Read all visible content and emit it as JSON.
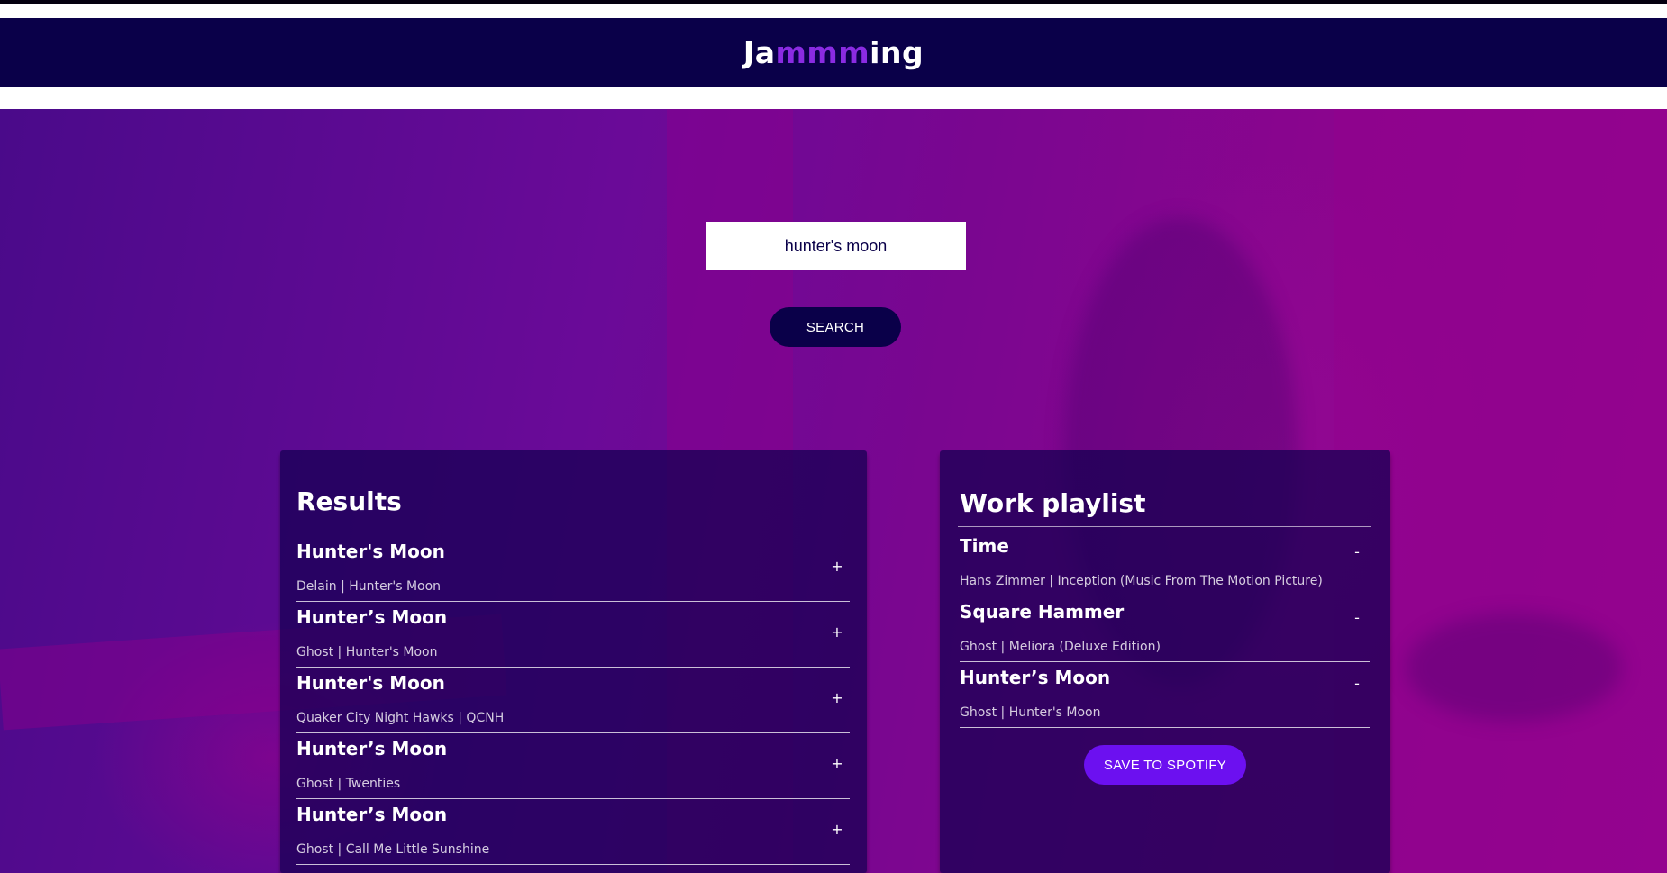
{
  "header": {
    "brand_prefix": "Ja",
    "brand_accent": "mmm",
    "brand_suffix": "ing"
  },
  "colors": {
    "header_bg": "#0a0049",
    "accent": "#8a2be2",
    "save_button": "#6c10f0"
  },
  "search": {
    "value": "hunter's moon",
    "button_label": "SEARCH"
  },
  "results": {
    "title": "Results",
    "add_icon": "+",
    "tracks": [
      {
        "name": "Hunter's Moon",
        "info": "Delain | Hunter's Moon"
      },
      {
        "name": "Hunter’s Moon",
        "info": "Ghost | Hunter's Moon"
      },
      {
        "name": "Hunter's Moon",
        "info": "Quaker City Night Hawks | QCNH"
      },
      {
        "name": "Hunter’s Moon",
        "info": "Ghost | Twenties"
      },
      {
        "name": "Hunter’s Moon",
        "info": "Ghost | Call Me Little Sunshine"
      }
    ]
  },
  "playlist": {
    "title": "Work playlist",
    "remove_icon": "-",
    "tracks": [
      {
        "name": "Time",
        "info": "Hans Zimmer | Inception (Music From The Motion Picture)"
      },
      {
        "name": "Square Hammer",
        "info": "Ghost | Meliora (Deluxe Edition)"
      },
      {
        "name": "Hunter’s Moon",
        "info": "Ghost | Hunter's Moon"
      }
    ],
    "save_label": "SAVE TO SPOTIFY"
  }
}
